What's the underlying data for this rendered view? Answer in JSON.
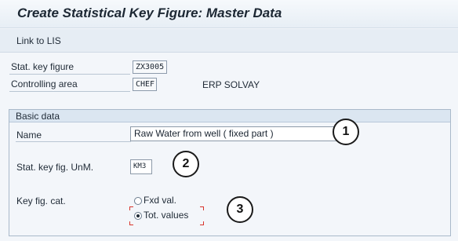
{
  "window": {
    "title": "Create Statistical Key Figure: Master Data"
  },
  "toolbar": {
    "link_to_lis": "Link to LIS"
  },
  "header": {
    "stat_key_figure_label": "Stat. key figure",
    "stat_key_figure_value": "ZX3005",
    "controlling_area_label": "Controlling area",
    "controlling_area_value": "CHEF",
    "controlling_area_desc": "ERP SOLVAY"
  },
  "basic_data": {
    "title": "Basic data",
    "name_label": "Name",
    "name_value": "Raw Water from well ( fixed part )",
    "unit_label": "Stat. key fig. UnM.",
    "unit_value": "KM3",
    "category_label": "Key fig. cat.",
    "options": [
      {
        "label": "Fxd val.",
        "selected": false
      },
      {
        "label": "Tot. values",
        "selected": true
      }
    ]
  },
  "callouts": [
    "1",
    "2",
    "3"
  ]
}
